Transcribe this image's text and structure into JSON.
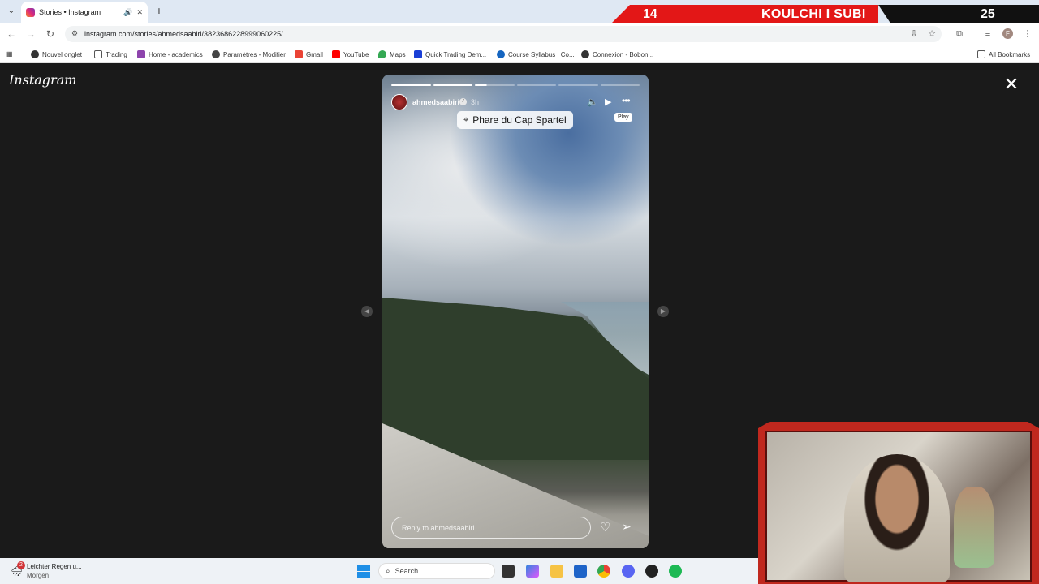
{
  "browser": {
    "tab_title": "Stories • Instagram",
    "tab_audio_icon": "speaker-icon",
    "url": "instagram.com/stories/ahmedsaabiri/3823686228999060225/",
    "bookmarks": [
      "Nouvel onglet",
      "Trading",
      "Home - academics",
      "Paramètres - Modifier",
      "Gmail",
      "YouTube",
      "Maps",
      "Quick Trading Dem...",
      "Course Syllabus | Co...",
      "Connexion - Bobon..."
    ],
    "all_bookmarks": "All Bookmarks",
    "profile_initial": "F"
  },
  "stream_overlay": {
    "left_score": "14",
    "title": "KOULCHI I SUBI",
    "right_score": "25",
    "accent_color": "#e31717"
  },
  "instagram": {
    "logo": "Instagram",
    "story": {
      "username": "ahmedsaabiri",
      "time_ago": "3h",
      "location": "Phare du Cap Spartel",
      "tooltip": "Play",
      "reply_placeholder": "Reply to ahmedsaabiri...",
      "segments": [
        "done",
        "done",
        "part",
        "todo",
        "todo",
        "todo"
      ]
    }
  },
  "taskbar": {
    "weather_title": "Leichter Regen u...",
    "weather_sub": "Morgen",
    "weather_badge": "2",
    "search_label": "Search"
  }
}
